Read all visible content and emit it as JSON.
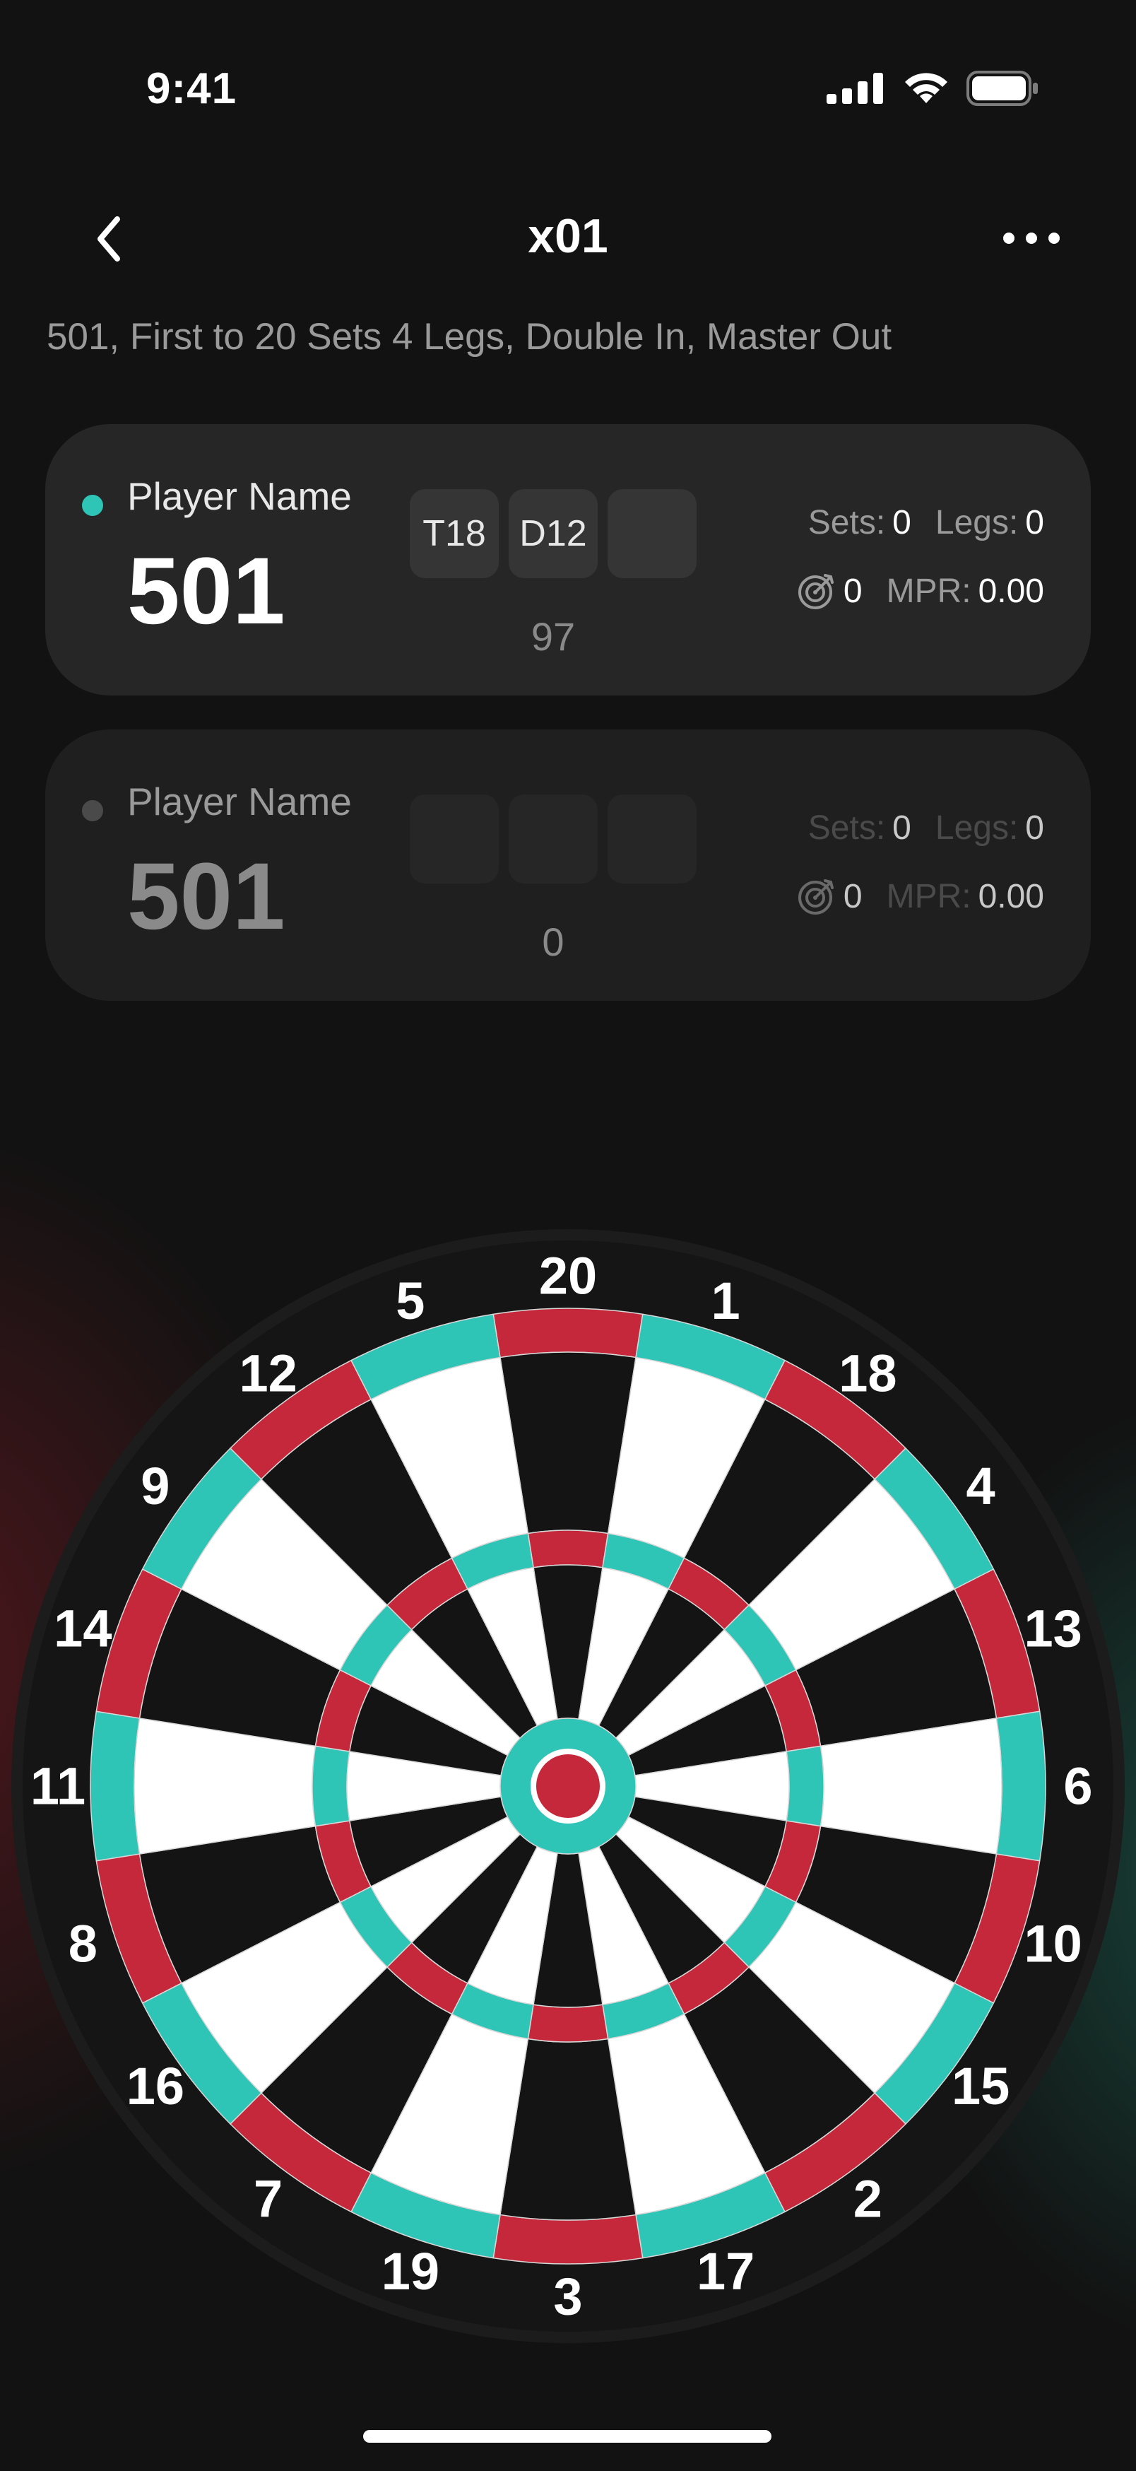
{
  "status_bar": {
    "time": "9:41"
  },
  "header": {
    "title": "x01"
  },
  "game_settings": "501, First to 20 Sets 4 Legs, Double In, Master Out",
  "players": [
    {
      "name": "Player Name",
      "score": "501",
      "active": true,
      "darts": [
        "T18",
        "D12",
        ""
      ],
      "turn_total": "97",
      "sets_label": "Sets:",
      "sets": "0",
      "legs_label": "Legs:",
      "legs": "0",
      "bullseye_count": "0",
      "mpr_label": "MPR:",
      "mpr": "0.00"
    },
    {
      "name": "Player Name",
      "score": "501",
      "active": false,
      "darts": [
        "",
        "",
        ""
      ],
      "turn_total": "0",
      "sets_label": "Sets:",
      "sets": "0",
      "legs_label": "Legs:",
      "legs": "0",
      "bullseye_count": "0",
      "mpr_label": "MPR:",
      "mpr": "0.00"
    }
  ],
  "dartboard": {
    "numbers": [
      20,
      1,
      18,
      4,
      13,
      6,
      10,
      15,
      2,
      17,
      3,
      19,
      7,
      16,
      8,
      11,
      14,
      9,
      12,
      5
    ],
    "colors": {
      "red": "#c5283a",
      "teal": "#2ec4b6",
      "black": "#141414",
      "white": "#ffffff",
      "rim": "#161616"
    }
  },
  "colors": {
    "active_dot": "#2ec4b6",
    "inactive_dot": "#4a4a4a",
    "card_bg": "#262626"
  }
}
